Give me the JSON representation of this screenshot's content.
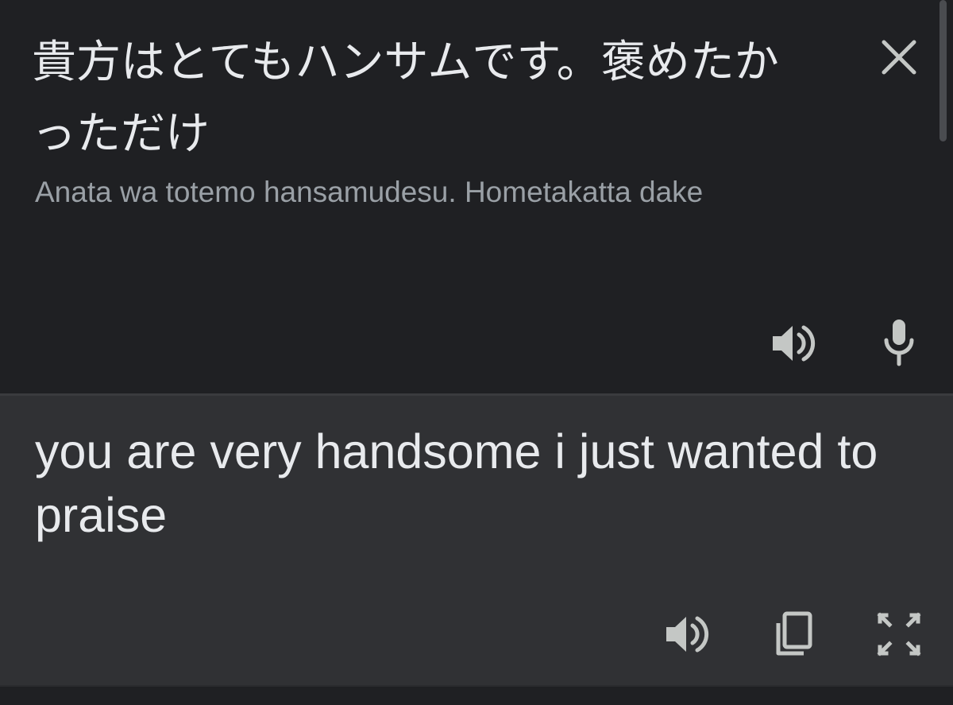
{
  "source": {
    "text": "貴方はとてもハンサムです。褒めたかっただけ",
    "romanization": "Anata wa totemo hansamudesu. Hometakatta dake",
    "icons": {
      "close": "close-icon",
      "speaker": "volume-icon",
      "microphone": "microphone-icon"
    }
  },
  "translation": {
    "text": "you are very handsome i just wanted to praise",
    "icons": {
      "speaker": "volume-icon",
      "copy": "copy-icon",
      "fullscreen": "fullscreen-icon"
    }
  },
  "colors": {
    "source_background": "#1f2023",
    "translation_background": "#303134",
    "primary_text": "#e8eaed",
    "secondary_text": "#9aa0a6",
    "icon": "#c4c7c5"
  }
}
